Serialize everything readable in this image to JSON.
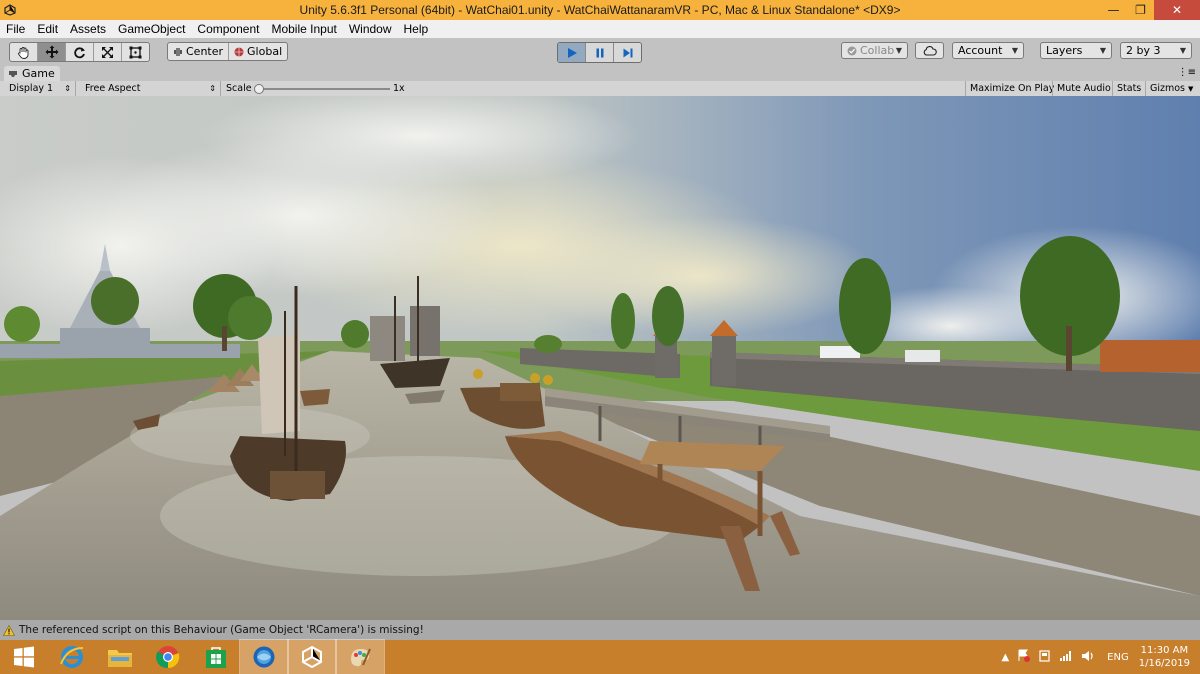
{
  "window": {
    "title": "Unity 5.6.3f1 Personal (64bit) - WatChai01.unity - WatChaiWattanaramVR - PC, Mac & Linux Standalone* <DX9>",
    "minimize_glyph": "—",
    "maximize_glyph": "❐",
    "close_glyph": "✕"
  },
  "menu": [
    "File",
    "Edit",
    "Assets",
    "GameObject",
    "Component",
    "Mobile Input",
    "Window",
    "Help"
  ],
  "toolbar": {
    "pivot_label": "Center",
    "space_label": "Global",
    "collab_label": "Collab",
    "account_label": "Account",
    "layers_label": "Layers",
    "layout_label": "2 by 3"
  },
  "game_view": {
    "tab_label": "Game",
    "display_label": "Display 1",
    "aspect_label": "Free Aspect",
    "scale_label": "Scale",
    "scale_value": "1x",
    "maximize_label": "Maximize On Play",
    "mute_label": "Mute Audio",
    "stats_label": "Stats",
    "gizmos_label": "Gizmos"
  },
  "status": {
    "message": "The referenced script on this Behaviour (Game Object 'RCamera') is missing!"
  },
  "taskbar": {
    "apps": [
      "windows-start-icon",
      "internet-explorer-icon",
      "file-explorer-icon",
      "chrome-icon",
      "store-icon",
      "browser-globe-icon",
      "unity-icon",
      "paint-icon"
    ],
    "active_app": "unity-icon",
    "language": "ENG",
    "time": "11:30 AM",
    "date": "1/16/2019"
  },
  "colors": {
    "titlebar": "#f6b23d",
    "taskbar": "#c87f2c",
    "play_active": "#93a9c0",
    "close_button": "#c74b3c"
  }
}
